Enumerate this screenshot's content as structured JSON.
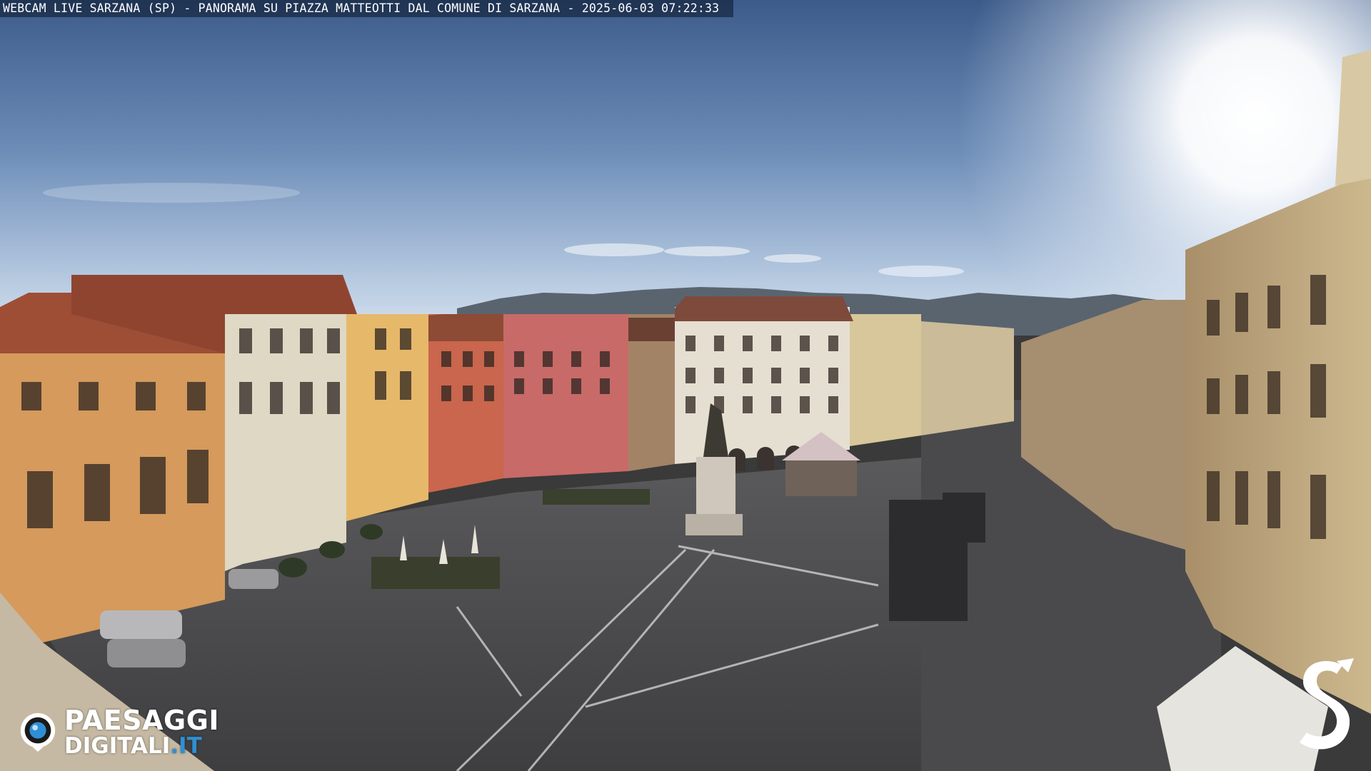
{
  "webcam": {
    "caption": "WEBCAM LIVE SARZANA (SP) - PANORAMA SU PIAZZA MATTEOTTI DAL COMUNE DI SARZANA - 2025-06-03  07:22:33"
  },
  "logo": {
    "line1": "PAESAGGI",
    "line2_main": "DIGITALI",
    "line2_tld": ".IT",
    "icon": "camera-lens-icon"
  },
  "watermark": {
    "icon": "brand-s-logo"
  },
  "colors": {
    "sky_top": "#3f5f8e",
    "sky_horizon": "#c9d8ea",
    "sun": "#ffffff",
    "pavement": "#4b4b4d",
    "logo_accent": "#2f8fd4"
  }
}
